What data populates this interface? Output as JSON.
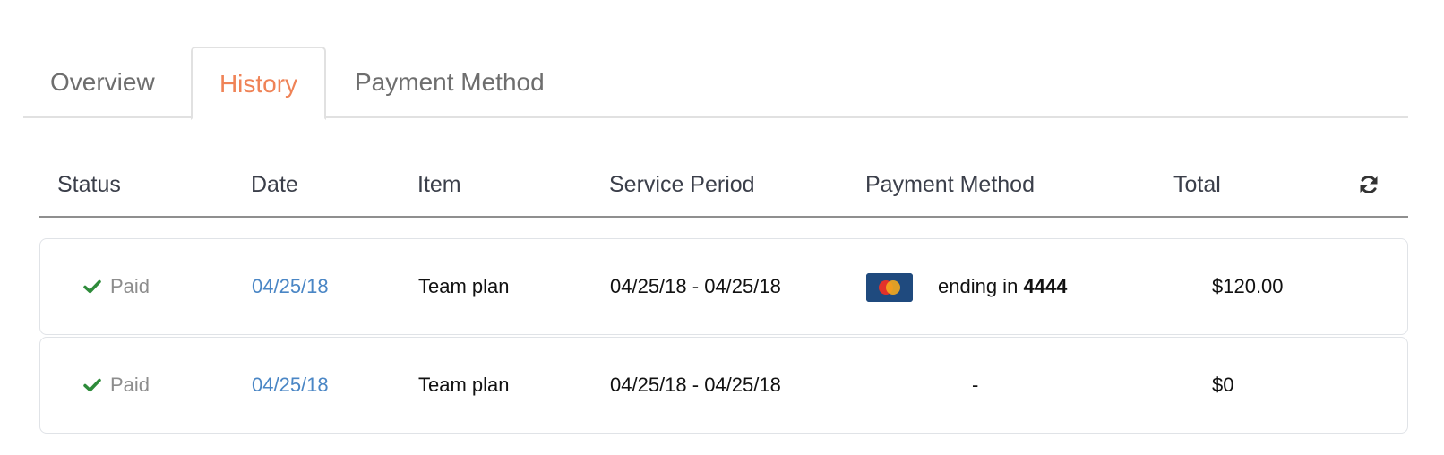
{
  "tabs": [
    {
      "label": "Overview",
      "active": false
    },
    {
      "label": "History",
      "active": true
    },
    {
      "label": "Payment Method",
      "active": false
    }
  ],
  "table": {
    "headers": [
      "Status",
      "Date",
      "Item",
      "Service Period",
      "Payment Method",
      "Total"
    ],
    "refresh_icon": "refresh-icon",
    "rows": [
      {
        "status": "Paid",
        "date": "04/25/18",
        "item": "Team plan",
        "service_period": "04/25/18 - 04/25/18",
        "payment_method": {
          "icon": "mastercard-icon",
          "prefix": "ending in",
          "last4": "4444"
        },
        "total": "$120.00"
      },
      {
        "status": "Paid",
        "date": "04/25/18",
        "item": "Team plan",
        "service_period": "04/25/18 - 04/25/18",
        "payment_method": {
          "empty": "-"
        },
        "total": "$0"
      }
    ]
  },
  "colors": {
    "accent": "#ef8357",
    "link": "#4a86c5",
    "success": "#2e8b3a",
    "muted": "#8d8d8d"
  }
}
